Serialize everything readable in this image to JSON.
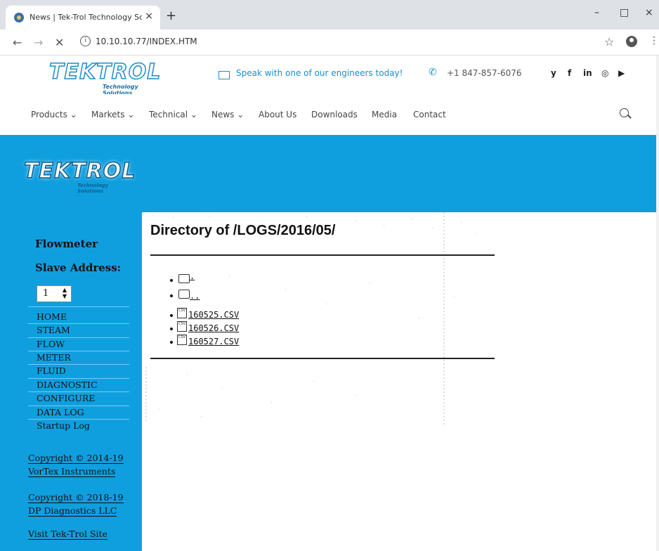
{
  "browser": {
    "tab_title": "News | Tek-Trol Technology Solut",
    "tab_close": "×",
    "new_tab": "+",
    "url": "10.10.10.77/INDEX.HTM",
    "win_minimize": "–",
    "win_maximize": "□",
    "win_close": "×"
  },
  "header": {
    "logo": "TEKTROL",
    "logo_sub": "Technology Solutions",
    "cta": "Speak with one of our engineers today!",
    "phone": "+1 847-857-6076",
    "social": [
      "y",
      "f",
      "in",
      "◎",
      "▶"
    ]
  },
  "nav": {
    "items": [
      "Products ⌄",
      "Markets ⌄",
      "Technical ⌄",
      "News ⌄",
      "About Us",
      "Downloads",
      "Media",
      "Contact"
    ]
  },
  "sidebar": {
    "title1": "Flowmeter",
    "title2": "Slave Address:",
    "spinner_value": "1",
    "links": [
      "HOME",
      "STEAM",
      "FLOW",
      "METER",
      "FLUID",
      "DIAGNOSTIC",
      "CONFIGURE",
      "DATA LOG",
      "Startup Log"
    ],
    "copy1_line1": "Copyright © 2014-19",
    "copy1_line2": "VorTex Instruments",
    "copy2_line1": "Copyright © 2018-19",
    "copy2_line2": "DP Diagnostics LLC",
    "visit": "Visit Tek-Trol Site"
  },
  "content": {
    "title": "Directory of /LOGS/2016/05/",
    "entries": [
      {
        "type": "folder",
        "name": "."
      },
      {
        "type": "folder",
        "name": ".."
      },
      {
        "type": "file",
        "name": "160525.CSV"
      },
      {
        "type": "file",
        "name": "160526.CSV"
      },
      {
        "type": "file",
        "name": "160527.CSV"
      }
    ],
    "file_icon_label": "CSV"
  }
}
